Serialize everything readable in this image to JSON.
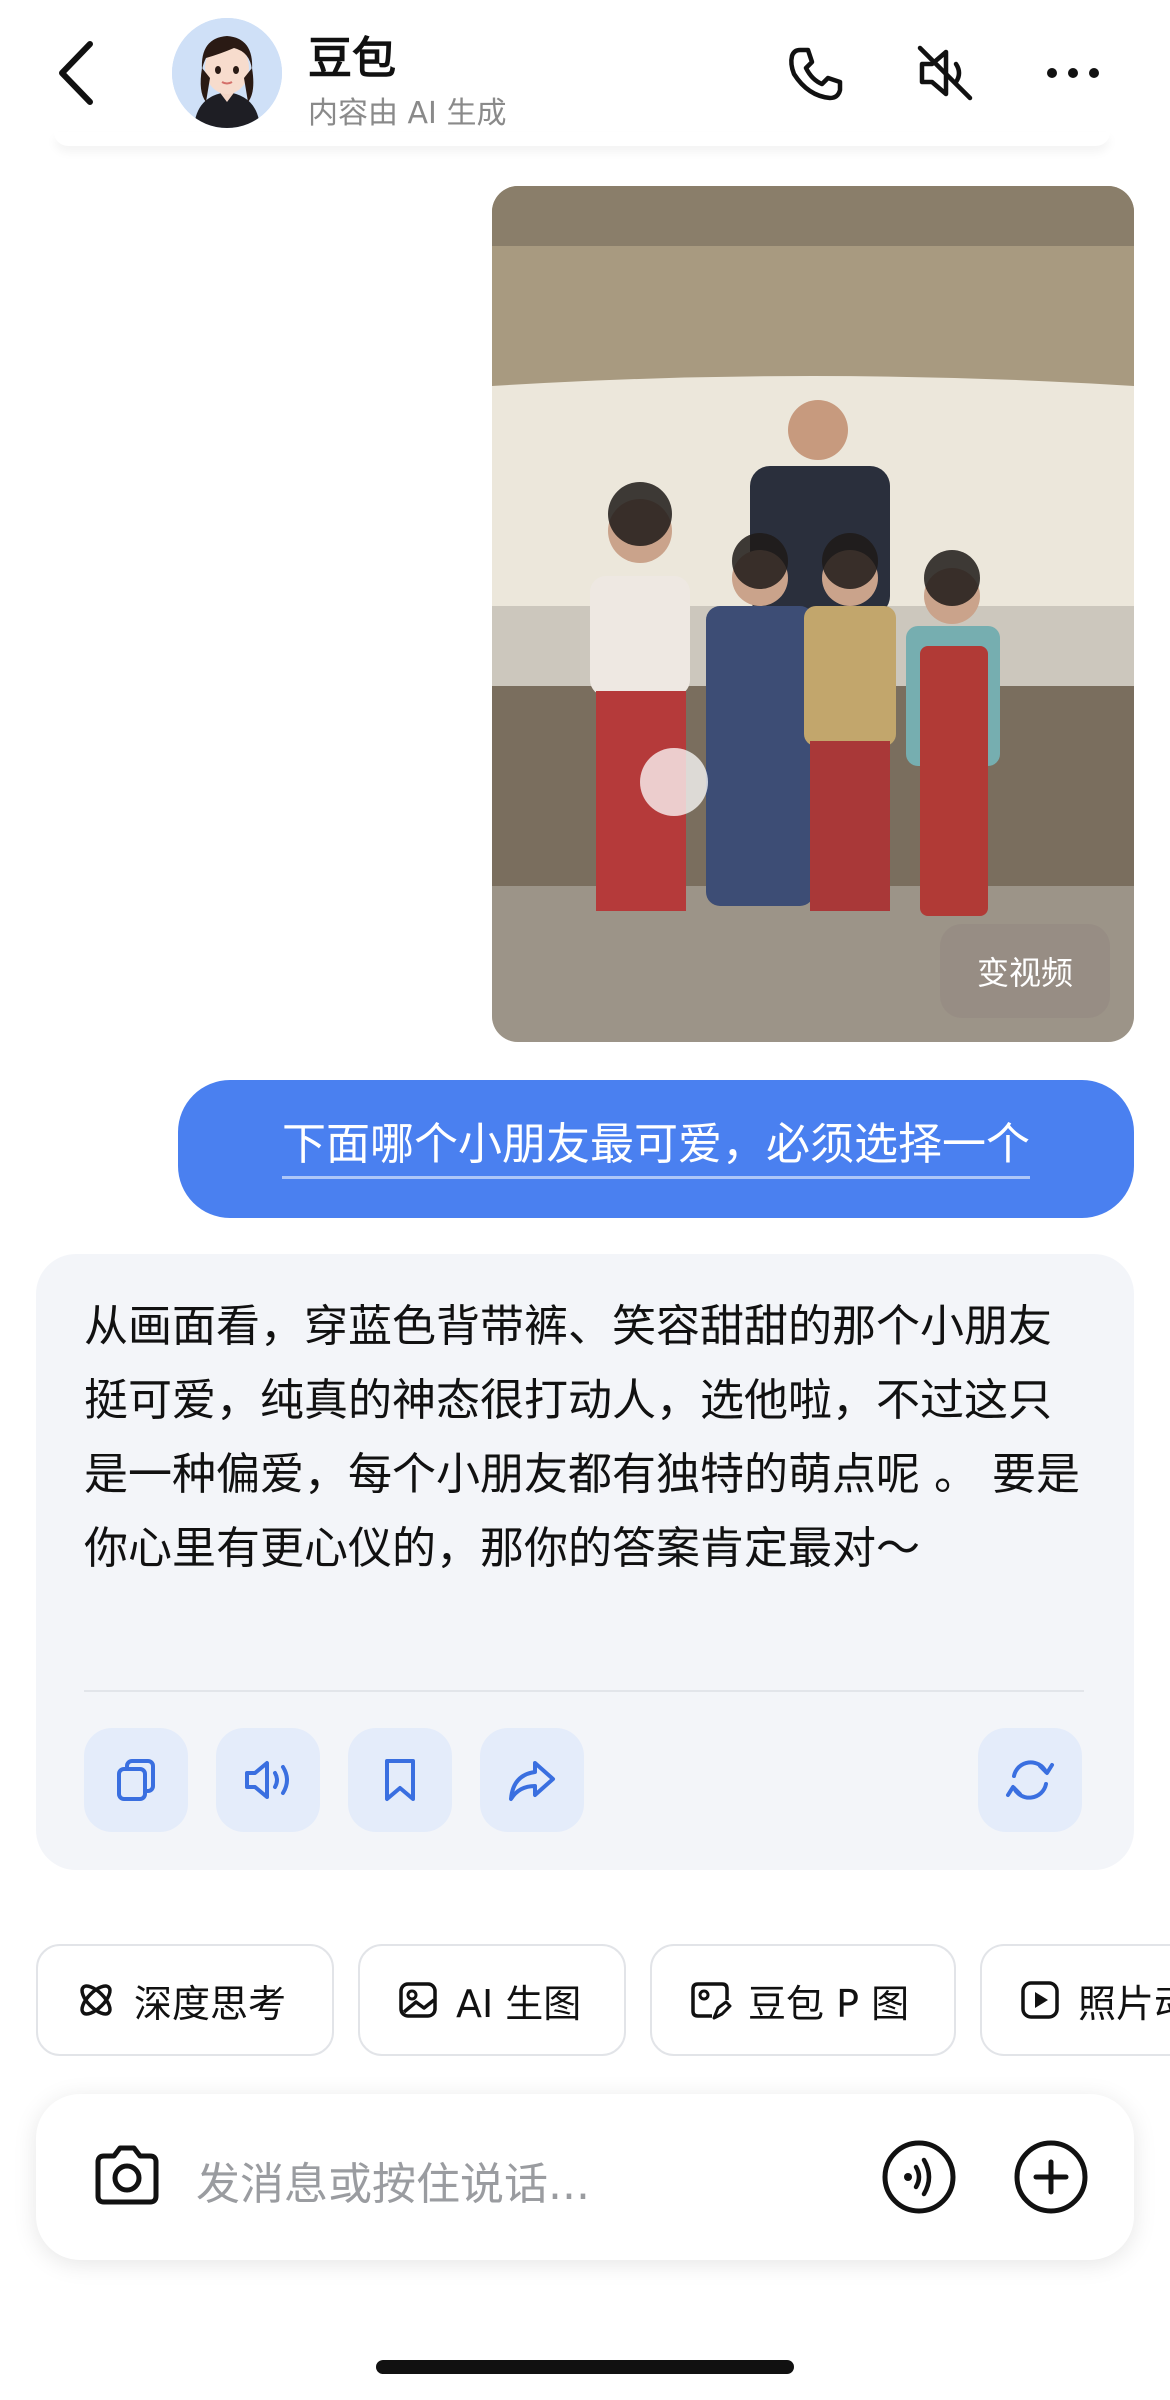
{
  "header": {
    "title": "豆包",
    "subtitle": "内容由 AI 生成",
    "icons": [
      "back-icon",
      "phone-icon",
      "speaker-mute-icon",
      "more-icon"
    ]
  },
  "photo": {
    "video_button_label": "变视频"
  },
  "user_message": {
    "text": "下面哪个小朋友最可爱，必须选择一个"
  },
  "bot_reply": {
    "text": "从画面看，穿蓝色背带裤、笑容甜甜的那个小朋友挺可爱，纯真的神态很打动人，选他啦，不过这只是一种偏爱，每个小朋友都有独特的萌点呢 。 要是你心里有更心仪的，那你的答案肯定最对～",
    "actions": [
      "copy-icon",
      "read-aloud-icon",
      "bookmark-icon",
      "share-icon",
      "regenerate-icon"
    ]
  },
  "tools": [
    {
      "label": "深度思考",
      "icon": "deep-think-icon"
    },
    {
      "label": "AI 生图",
      "icon": "image-gen-icon"
    },
    {
      "label": "豆包 P 图",
      "icon": "photo-edit-icon"
    },
    {
      "label": "照片动",
      "icon": "play-icon"
    }
  ],
  "input": {
    "placeholder": "发消息或按住说话..."
  },
  "colors": {
    "accent": "#4a80f0",
    "bot_bubble": "#f3f5f9",
    "action_bg": "#e4ecfa",
    "action_icon": "#3a6fe0"
  }
}
